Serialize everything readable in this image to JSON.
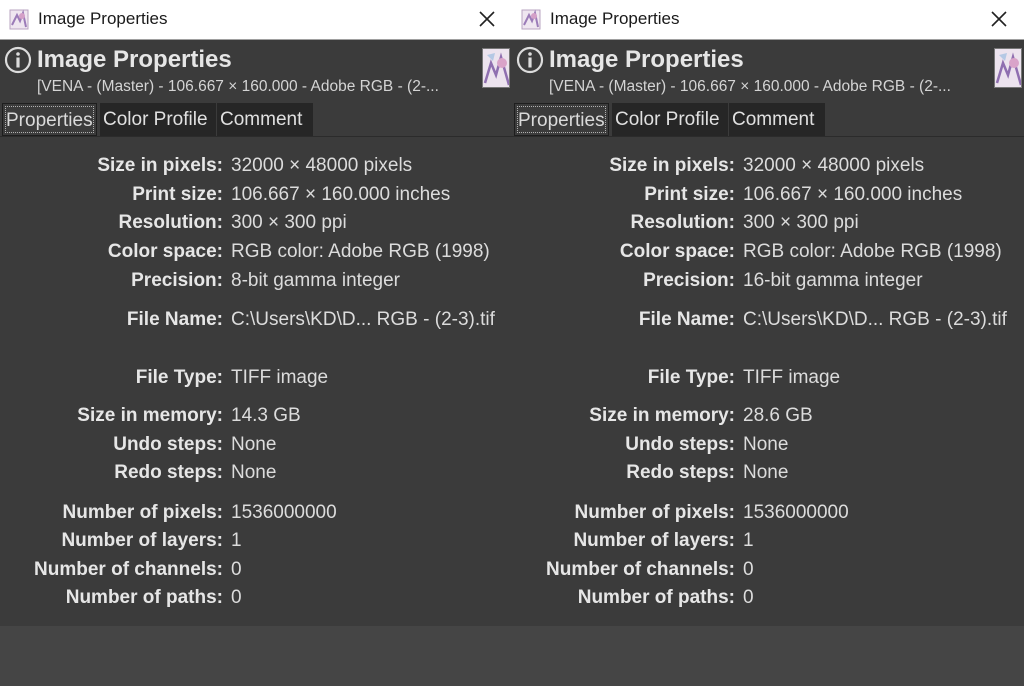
{
  "left": {
    "window_title": "Image Properties",
    "header": {
      "title": "Image Properties",
      "subtitle": "[VENA - (Master) - 106.667 × 160.000 - Adobe RGB - (2-..."
    },
    "tabs": [
      {
        "label": "Properties",
        "active": true
      },
      {
        "label": "Color Profile",
        "active": false
      },
      {
        "label": "Comment",
        "active": false
      }
    ],
    "properties": [
      {
        "label": "Size in pixels:",
        "value": "32000 × 48000 pixels"
      },
      {
        "label": "Print size:",
        "value": "106.667 × 160.000 inches"
      },
      {
        "label": "Resolution:",
        "value": "300 × 300 ppi"
      },
      {
        "label": "Color space:",
        "value": "RGB color: Adobe RGB (1998)"
      },
      {
        "label": "Precision:",
        "value": "8-bit gamma integer"
      },
      {
        "label": "File Name:",
        "value": "C:\\Users\\KD\\D... RGB - (2-3).tif"
      },
      {
        "label": "File Type:",
        "value": "TIFF image"
      },
      {
        "label": "Size in memory:",
        "value": "14.3 GB"
      },
      {
        "label": "Undo steps:",
        "value": "None"
      },
      {
        "label": "Redo steps:",
        "value": "None"
      },
      {
        "label": "Number of pixels:",
        "value": "1536000000"
      },
      {
        "label": "Number of layers:",
        "value": "1"
      },
      {
        "label": "Number of channels:",
        "value": "0"
      },
      {
        "label": "Number of paths:",
        "value": "0"
      }
    ]
  },
  "right": {
    "window_title": "Image Properties",
    "header": {
      "title": "Image Properties",
      "subtitle": "[VENA - (Master) - 106.667 × 160.000 - Adobe RGB - (2-..."
    },
    "tabs": [
      {
        "label": "Properties",
        "active": true
      },
      {
        "label": "Color Profile",
        "active": false
      },
      {
        "label": "Comment",
        "active": false
      }
    ],
    "properties": [
      {
        "label": "Size in pixels:",
        "value": "32000 × 48000 pixels"
      },
      {
        "label": "Print size:",
        "value": "106.667 × 160.000 inches"
      },
      {
        "label": "Resolution:",
        "value": "300 × 300 ppi"
      },
      {
        "label": "Color space:",
        "value": "RGB color: Adobe RGB (1998)"
      },
      {
        "label": "Precision:",
        "value": "16-bit gamma integer"
      },
      {
        "label": "File Name:",
        "value": "C:\\Users\\KD\\D... RGB - (2-3).tif"
      },
      {
        "label": "File Type:",
        "value": "TIFF image"
      },
      {
        "label": "Size in memory:",
        "value": "28.6 GB"
      },
      {
        "label": "Undo steps:",
        "value": "None"
      },
      {
        "label": "Redo steps:",
        "value": "None"
      },
      {
        "label": "Number of pixels:",
        "value": "1536000000"
      },
      {
        "label": "Number of layers:",
        "value": "1"
      },
      {
        "label": "Number of channels:",
        "value": "0"
      },
      {
        "label": "Number of paths:",
        "value": "0"
      }
    ]
  }
}
